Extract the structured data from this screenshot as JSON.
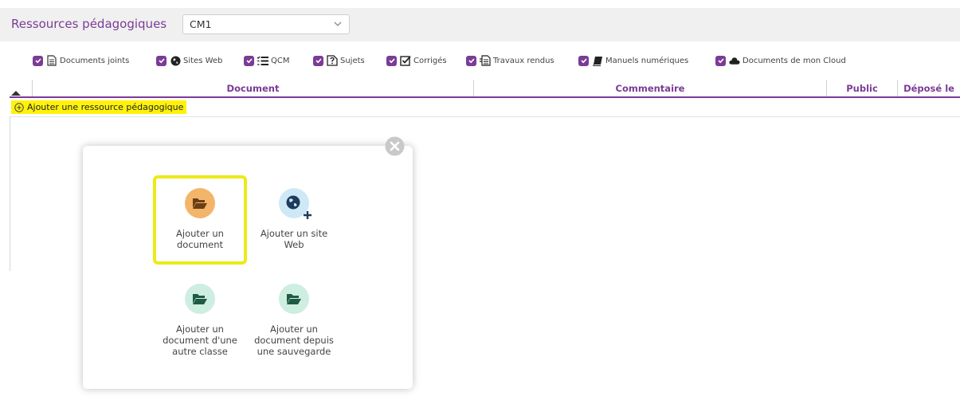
{
  "header": {
    "title": "Ressources pédagogiques",
    "class_select": {
      "value": "CM1"
    }
  },
  "filters": [
    {
      "label": "Documents joints",
      "icon": "document-icon",
      "checked": true
    },
    {
      "label": "Sites Web",
      "icon": "globe-icon",
      "checked": true
    },
    {
      "label": "QCM",
      "icon": "list-icon",
      "checked": true
    },
    {
      "label": "Sujets",
      "icon": "question-document-icon",
      "checked": true
    },
    {
      "label": "Corrigés",
      "icon": "checkbox-icon",
      "checked": true
    },
    {
      "label": "Travaux rendus",
      "icon": "return-document-icon",
      "checked": true
    },
    {
      "label": "Manuels numériques",
      "icon": "book-icon",
      "checked": true
    },
    {
      "label": "Documents de mon Cloud",
      "icon": "cloud-icon",
      "checked": true
    }
  ],
  "table": {
    "columns": [
      "Document",
      "Commentaire",
      "Public",
      "Déposé le"
    ],
    "add_resource_label": "Ajouter une ressource pédagogique"
  },
  "popup": {
    "options": [
      {
        "label": "Ajouter un\ndocument",
        "icon": "folder-open-icon",
        "highlighted": true
      },
      {
        "label": "Ajouter un site\nWeb",
        "icon": "globe-plus-icon"
      },
      {
        "label": "Ajouter un\ndocument d'une\nautre classe",
        "icon": "folder-open-icon"
      },
      {
        "label": "Ajouter un\ndocument depuis\nune sauvegarde",
        "icon": "folder-open-icon"
      }
    ]
  },
  "colors": {
    "accent": "#7b3b96",
    "highlight": "#fff20a",
    "highlight_border": "#ecea19",
    "folder_orange_bg": "#f3b56a",
    "globe_bg": "#cfe8f6",
    "folder_green_bg": "#cdeee0"
  }
}
